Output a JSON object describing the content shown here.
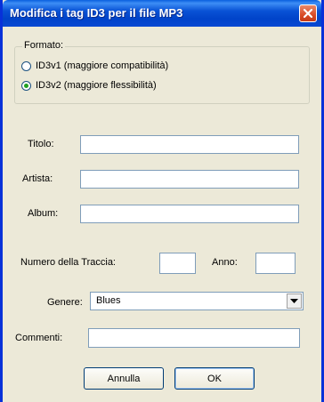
{
  "window": {
    "title": "Modifica i tag ID3 per il file MP3"
  },
  "format": {
    "legend": "Formato:",
    "options": [
      {
        "label": "ID3v1 (maggiore compatibilità)",
        "selected": false
      },
      {
        "label": "ID3v2 (maggiore flessibilità)",
        "selected": true
      }
    ]
  },
  "fields": {
    "title_label": "Titolo:",
    "title_value": "",
    "artist_label": "Artista:",
    "artist_value": "",
    "album_label": "Album:",
    "album_value": "",
    "track_label": "Numero della Traccia:",
    "track_value": "",
    "year_label": "Anno:",
    "year_value": "",
    "genre_label": "Genere:",
    "genre_value": "Blues",
    "comments_label": "Commenti:",
    "comments_value": ""
  },
  "buttons": {
    "cancel": "Annulla",
    "ok": "OK"
  },
  "colors": {
    "titlebar": "#0a53d6",
    "close": "#d94b26",
    "background": "#ece9d8"
  }
}
